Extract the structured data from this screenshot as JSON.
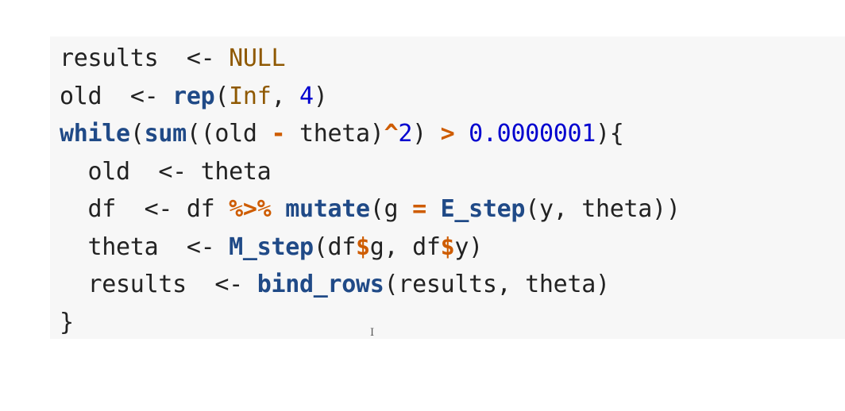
{
  "code": {
    "lines": [
      [
        {
          "t": "results  ",
          "c": "text"
        },
        {
          "t": "<-",
          "c": "text"
        },
        {
          "t": " ",
          "c": "text"
        },
        {
          "t": "NULL",
          "c": "const"
        }
      ],
      [
        {
          "t": "old  ",
          "c": "text"
        },
        {
          "t": "<-",
          "c": "text"
        },
        {
          "t": " ",
          "c": "text"
        },
        {
          "t": "rep",
          "c": "fn"
        },
        {
          "t": "(",
          "c": "text"
        },
        {
          "t": "Inf",
          "c": "const"
        },
        {
          "t": ", ",
          "c": "text"
        },
        {
          "t": "4",
          "c": "num"
        },
        {
          "t": ")",
          "c": "text"
        }
      ],
      [
        {
          "t": "while",
          "c": "kw"
        },
        {
          "t": "(",
          "c": "text"
        },
        {
          "t": "sum",
          "c": "fn"
        },
        {
          "t": "((old ",
          "c": "text"
        },
        {
          "t": "-",
          "c": "op"
        },
        {
          "t": " theta)",
          "c": "text"
        },
        {
          "t": "^",
          "c": "op"
        },
        {
          "t": "2",
          "c": "num"
        },
        {
          "t": ") ",
          "c": "text"
        },
        {
          "t": ">",
          "c": "op"
        },
        {
          "t": " ",
          "c": "text"
        },
        {
          "t": "0.0000001",
          "c": "num"
        },
        {
          "t": "){",
          "c": "text"
        }
      ],
      [
        {
          "t": "  old  ",
          "c": "text"
        },
        {
          "t": "<-",
          "c": "text"
        },
        {
          "t": " theta",
          "c": "text"
        }
      ],
      [
        {
          "t": "  df  ",
          "c": "text"
        },
        {
          "t": "<-",
          "c": "text"
        },
        {
          "t": " df ",
          "c": "text"
        },
        {
          "t": "%>%",
          "c": "op"
        },
        {
          "t": " ",
          "c": "text"
        },
        {
          "t": "mutate",
          "c": "fn"
        },
        {
          "t": "(g ",
          "c": "text"
        },
        {
          "t": "=",
          "c": "op"
        },
        {
          "t": " ",
          "c": "text"
        },
        {
          "t": "E_step",
          "c": "fn"
        },
        {
          "t": "(y, theta))",
          "c": "text"
        }
      ],
      [
        {
          "t": "  theta  ",
          "c": "text"
        },
        {
          "t": "<-",
          "c": "text"
        },
        {
          "t": " ",
          "c": "text"
        },
        {
          "t": "M_step",
          "c": "fn"
        },
        {
          "t": "(df",
          "c": "text"
        },
        {
          "t": "$",
          "c": "op"
        },
        {
          "t": "g, df",
          "c": "text"
        },
        {
          "t": "$",
          "c": "op"
        },
        {
          "t": "y)",
          "c": "text"
        }
      ],
      [
        {
          "t": "  results  ",
          "c": "text"
        },
        {
          "t": "<-",
          "c": "text"
        },
        {
          "t": " ",
          "c": "text"
        },
        {
          "t": "bind_rows",
          "c": "fn"
        },
        {
          "t": "(results, theta)",
          "c": "text"
        }
      ],
      [
        {
          "t": "}",
          "c": "text"
        }
      ]
    ]
  },
  "token_colors": {
    "text": "#222222",
    "const": "#8f5902",
    "num": "#0000cf",
    "fn": "#204a87",
    "kw": "#204a87",
    "op": "#ce5c00"
  },
  "cursor": {
    "icon": "text-cursor-icon",
    "glyph": "I"
  }
}
